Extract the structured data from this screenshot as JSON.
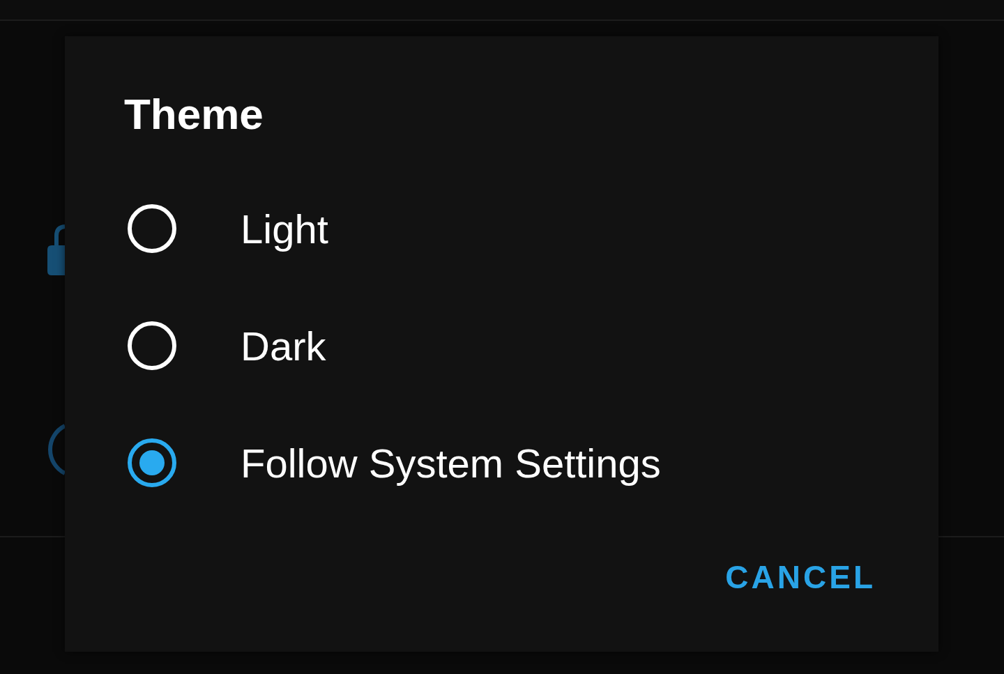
{
  "dialog": {
    "title": "Theme",
    "options": [
      {
        "label": "Light",
        "selected": false
      },
      {
        "label": "Dark",
        "selected": false
      },
      {
        "label": "Follow System Settings",
        "selected": true
      }
    ],
    "buttons": [
      "CANCEL"
    ]
  }
}
